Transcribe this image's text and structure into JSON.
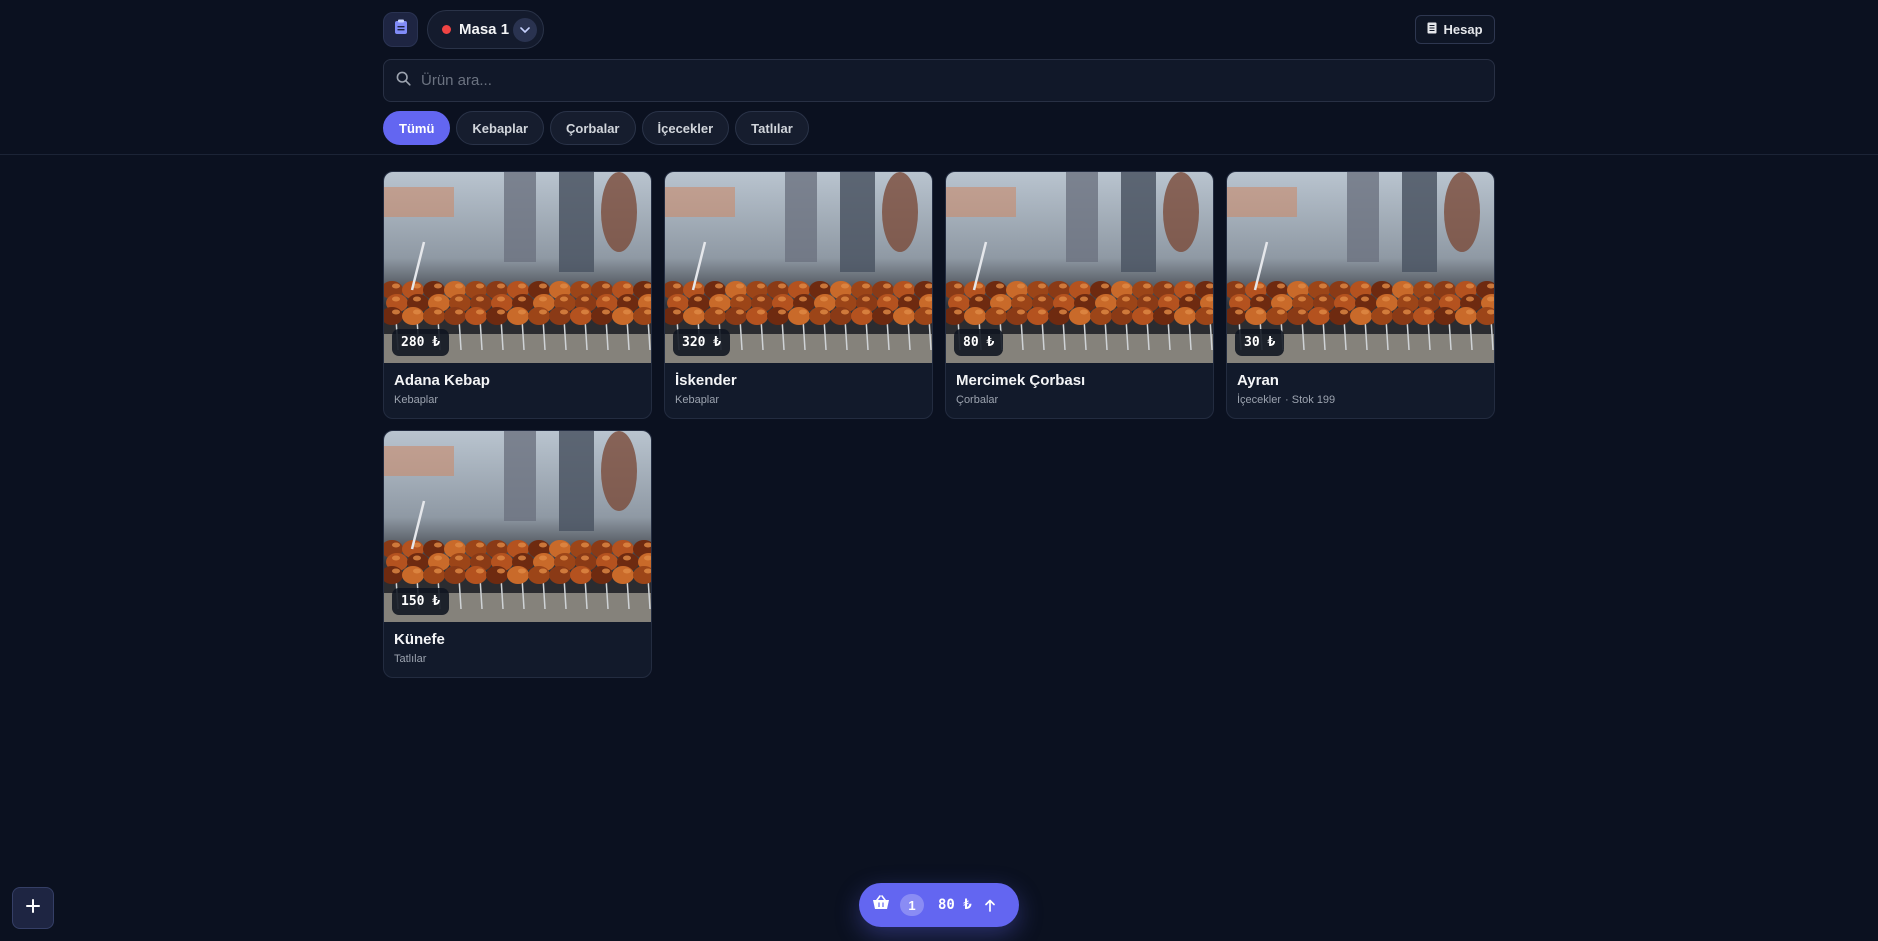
{
  "header": {
    "table": {
      "label": "Masa 1",
      "status_color": "#ef4444"
    },
    "account_label": "Hesap"
  },
  "search": {
    "placeholder": "Ürün ara..."
  },
  "categories": [
    {
      "label": "Tümü",
      "active": true
    },
    {
      "label": "Kebaplar",
      "active": false
    },
    {
      "label": "Çorbalar",
      "active": false
    },
    {
      "label": "İçecekler",
      "active": false
    },
    {
      "label": "Tatlılar",
      "active": false
    }
  ],
  "products": [
    {
      "name": "Adana Kebap",
      "category": "Kebaplar",
      "price": "280 ₺",
      "stock": ""
    },
    {
      "name": "İskender",
      "category": "Kebaplar",
      "price": "320 ₺",
      "stock": ""
    },
    {
      "name": "Mercimek Çorbası",
      "category": "Çorbalar",
      "price": "80 ₺",
      "stock": ""
    },
    {
      "name": "Ayran",
      "category": "İçecekler",
      "price": "30 ₺",
      "stock": "· Stok 199"
    },
    {
      "name": "Künefe",
      "category": "Tatlılar",
      "price": "150 ₺",
      "stock": ""
    }
  ],
  "cart": {
    "count": "1",
    "total": "80 ₺"
  },
  "colors": {
    "accent": "#6366f1",
    "background": "#0b1120",
    "card": "#121a2b"
  },
  "icons": [
    "clipboard-icon",
    "chevron-down-icon",
    "receipt-icon",
    "search-icon",
    "basket-icon",
    "arrow-up-icon",
    "plus-icon"
  ]
}
